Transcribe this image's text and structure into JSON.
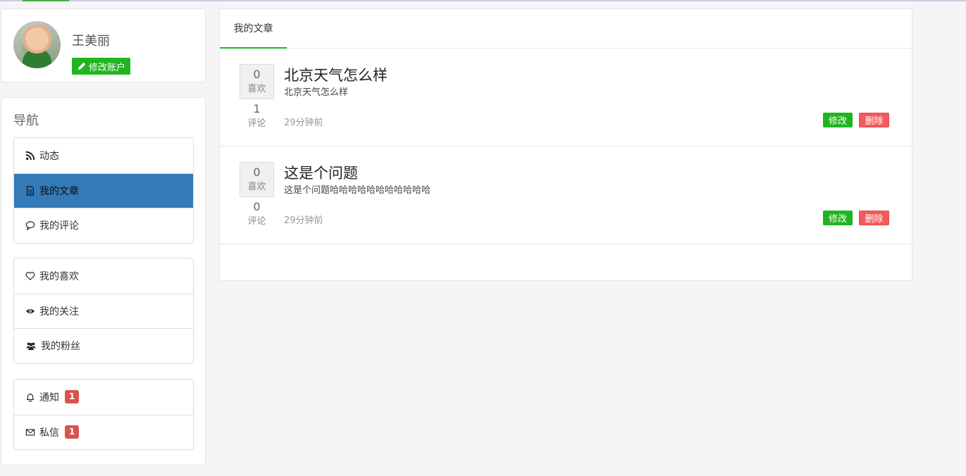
{
  "profile": {
    "name": "王美丽",
    "edit_label": "修改账户"
  },
  "nav": {
    "title": "导航",
    "groups": [
      {
        "items": [
          {
            "label": "动态",
            "icon": "rss-icon",
            "active": false
          },
          {
            "label": "我的文章",
            "icon": "file-icon",
            "active": true
          },
          {
            "label": "我的评论",
            "icon": "comment-icon",
            "active": false
          }
        ]
      },
      {
        "items": [
          {
            "label": "我的喜欢",
            "icon": "heart-icon",
            "active": false
          },
          {
            "label": "我的关注",
            "icon": "eye-icon",
            "active": false
          },
          {
            "label": "我的粉丝",
            "icon": "users-icon",
            "active": false
          }
        ]
      },
      {
        "items": [
          {
            "label": "通知",
            "icon": "bell-icon",
            "badge": "1"
          },
          {
            "label": "私信",
            "icon": "envelope-icon",
            "badge": "1"
          }
        ]
      }
    ]
  },
  "main": {
    "tab_label": "我的文章",
    "articles": [
      {
        "likes": "0",
        "likes_label": "喜欢",
        "comments": "1",
        "comments_label": "评论",
        "title": "北京天气怎么样",
        "summary": "北京天气怎么样",
        "time": "29分钟前",
        "edit_label": "修改",
        "delete_label": "删除"
      },
      {
        "likes": "0",
        "likes_label": "喜欢",
        "comments": "0",
        "comments_label": "评论",
        "title": "这是个问题",
        "summary": "这是个问题哈哈哈哈哈哈哈哈哈哈哈",
        "time": "29分钟前",
        "edit_label": "修改",
        "delete_label": "删除"
      }
    ]
  },
  "colors": {
    "accent_green": "#1fb51f",
    "active_blue": "#337ab7",
    "danger_red": "#f45a5a",
    "badge_red": "#d9534f"
  }
}
